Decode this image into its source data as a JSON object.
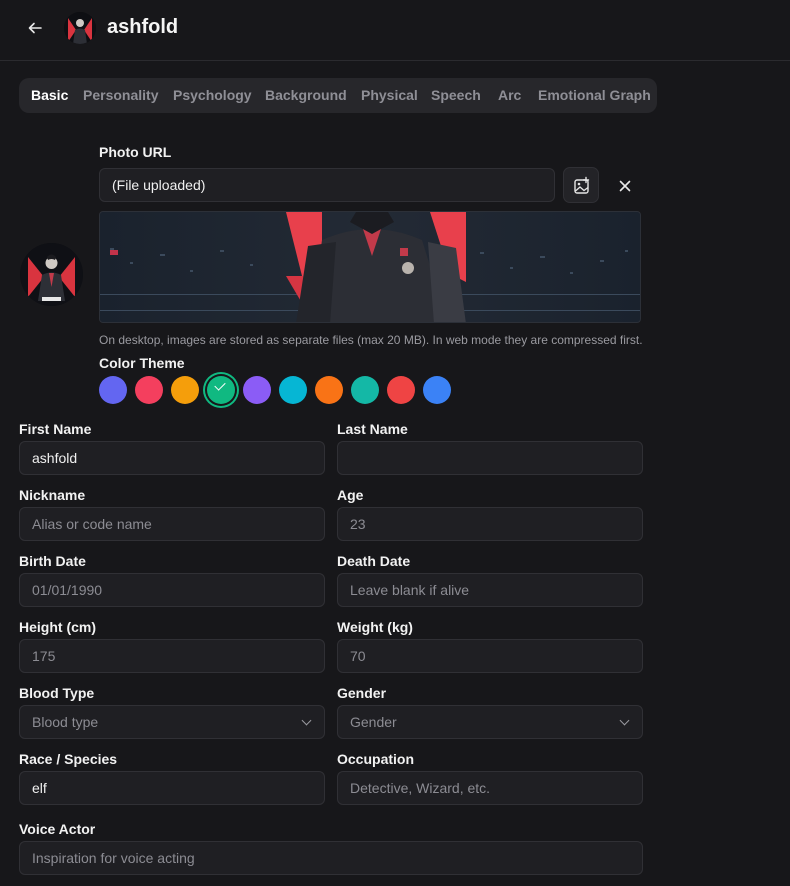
{
  "header": {
    "back_icon": "arrow-left-icon",
    "name": "ashfold"
  },
  "tabs": [
    "Basic",
    "Personality",
    "Psychology",
    "Background",
    "Physical",
    "Speech",
    "Arc",
    "Emotional Graph"
  ],
  "active_tab": "Basic",
  "photo": {
    "label": "Photo URL",
    "value": "(File uploaded)",
    "upload_icon": "image-plus-icon",
    "clear_icon": "close-icon",
    "hint": "On desktop, images are stored as separate files (max 20 MB). In web mode they are compressed first."
  },
  "color_theme": {
    "label": "Color Theme",
    "colors": [
      "#6366f1",
      "#f43f5e",
      "#f59e0b",
      "#10b981",
      "#8b5cf6",
      "#06b6d4",
      "#f97316",
      "#14b8a6",
      "#ef4444",
      "#3b82f6"
    ],
    "selected_index": 3
  },
  "fields": {
    "first_name": {
      "label": "First Name",
      "value": "ashfold"
    },
    "last_name": {
      "label": "Last Name",
      "value": ""
    },
    "nickname": {
      "label": "Nickname",
      "placeholder": "Alias or code name"
    },
    "age": {
      "label": "Age",
      "value": "23"
    },
    "birth_date": {
      "label": "Birth Date",
      "value": "01/01/1990"
    },
    "death_date": {
      "label": "Death Date",
      "placeholder": "Leave blank if alive"
    },
    "height": {
      "label": "Height (cm)",
      "value": "175"
    },
    "weight": {
      "label": "Weight (kg)",
      "value": "70"
    },
    "blood_type": {
      "label": "Blood Type",
      "placeholder": "Blood type"
    },
    "gender": {
      "label": "Gender",
      "placeholder": "Gender"
    },
    "race": {
      "label": "Race / Species",
      "value": "elf"
    },
    "occupation": {
      "label": "Occupation",
      "placeholder": "Detective, Wizard, etc."
    },
    "voice_actor": {
      "label": "Voice Actor",
      "placeholder": "Inspiration for voice acting"
    }
  }
}
